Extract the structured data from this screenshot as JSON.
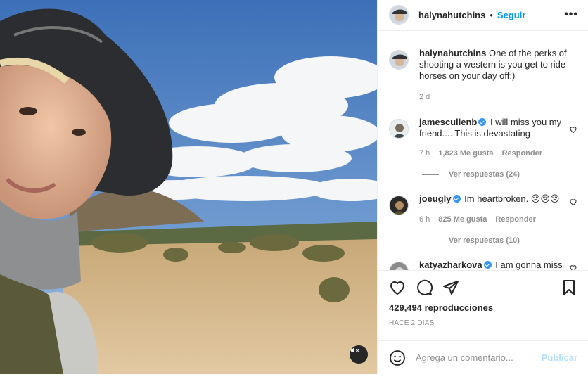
{
  "post": {
    "username": "halynahutchins",
    "separator": "•",
    "follow_label": "Seguir",
    "more_icon": "more-horizontal-icon",
    "caption": "One of the perks of shooting a western is you get to ride horses on your day off:)",
    "caption_age": "2 d"
  },
  "comments": [
    {
      "username": "jamescullenb",
      "verified": true,
      "text": "I will miss you my friend.... This is devastating",
      "age": "7 h",
      "likes": "1,823 Me gusta",
      "reply_label": "Responder",
      "view_replies": "Ver respuestas (24)"
    },
    {
      "username": "joeugly",
      "verified": true,
      "text": "Im heartbroken. 😢😢😢",
      "age": "6 h",
      "likes": "825 Me gusta",
      "reply_label": "Responder",
      "view_replies": "Ver respuestas (10)"
    },
    {
      "username": "katyazharkova",
      "verified": true,
      "text": "I am gonna miss"
    }
  ],
  "actions": {
    "views": "429,494 reproducciones",
    "posted_ago": "HACE 2 DÍAS"
  },
  "add_comment": {
    "placeholder": "Agrega un comentario...",
    "publish_label": "Publicar"
  },
  "colors": {
    "accent": "#0095f6",
    "publish_disabled": "#b2dffc",
    "muted_text": "#8e8e8e",
    "verified": "#3897f0"
  }
}
